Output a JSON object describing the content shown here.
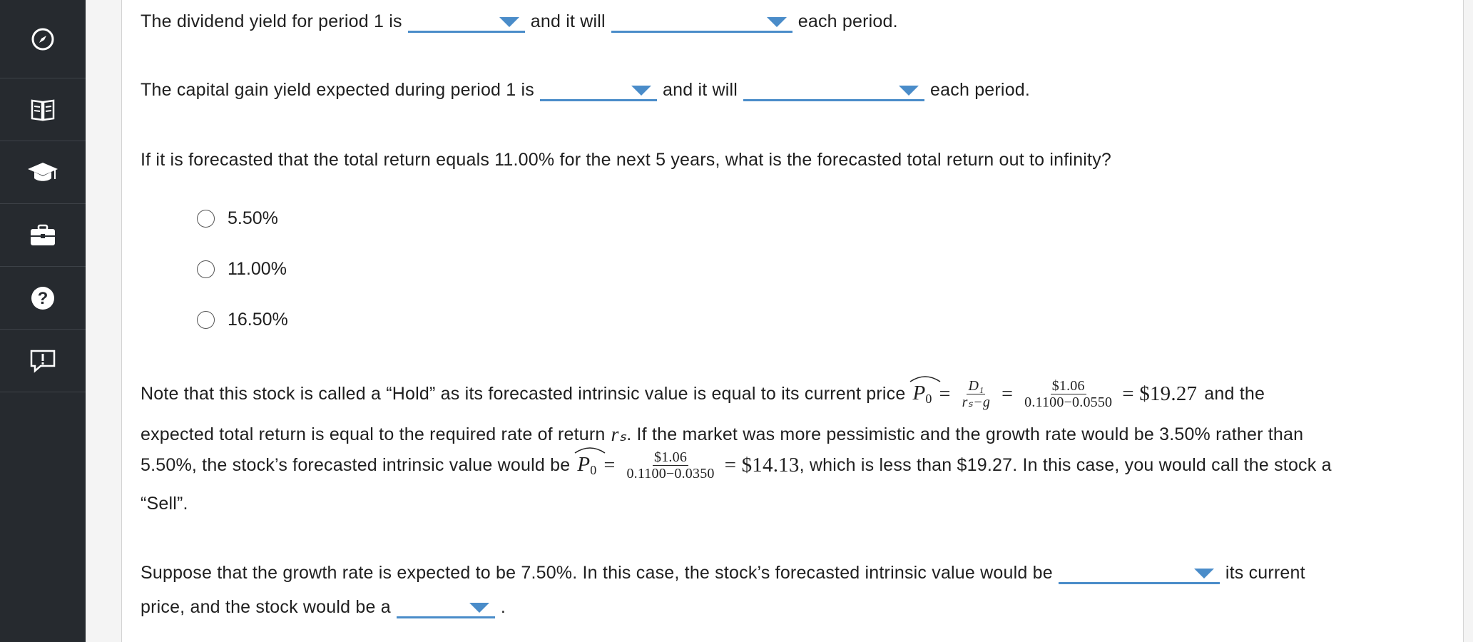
{
  "sidebar": {
    "items": [
      {
        "icon": "compass-icon"
      },
      {
        "icon": "book-icon"
      },
      {
        "icon": "graduation-cap-icon"
      },
      {
        "icon": "briefcase-icon"
      },
      {
        "icon": "help-icon"
      },
      {
        "icon": "feedback-icon"
      }
    ]
  },
  "q1": {
    "prefix": "The dividend yield for period 1 is",
    "middle": "and it will",
    "suffix": "each period."
  },
  "q2": {
    "prefix": "The capital gain yield expected during period 1 is",
    "middle": "and it will",
    "suffix": "each period."
  },
  "q3": {
    "question": "If it is forecasted that the total return equals 11.00% for the next 5 years, what is the forecasted total return out to infinity?",
    "options": [
      "5.50%",
      "11.00%",
      "16.50%"
    ]
  },
  "note": {
    "line1_prefix": "Note that this stock is called a “Hold” as its forecasted intrinsic value is equal to its current price",
    "p_symbol": "P",
    "p_sub": "0",
    "frac1_num": "D₁",
    "frac1_den": "rₛ−g",
    "frac2_num": "$1.06",
    "frac2_den": "0.1100−0.0550",
    "result1": "= $19.27",
    "line1_suffix": "and the",
    "line2_prefix": "expected total return is equal to the required rate of return",
    "rs": "rₛ",
    "line2_suffix": ". If the market was more pessimistic and the growth rate would be 3.50% rather than",
    "line3_prefix": "5.50%, the stock’s forecasted intrinsic value would be",
    "frac3_num": "$1.06",
    "frac3_den": "0.1100−0.0350",
    "result2": "= $14.13",
    "line3_suffix": ", which is less than $19.27. In this case, you would call the stock a",
    "line4": "“Sell”."
  },
  "q4": {
    "prefix": "Suppose that the growth rate is expected to be 7.50%. In this case, the stock’s forecasted intrinsic value would be",
    "middle": "its current",
    "line2_prefix": "price, and the stock would be a",
    "line2_suffix": "."
  },
  "colors": {
    "sidebar_bg": "#262a2f",
    "accent": "#4a8cc9"
  }
}
